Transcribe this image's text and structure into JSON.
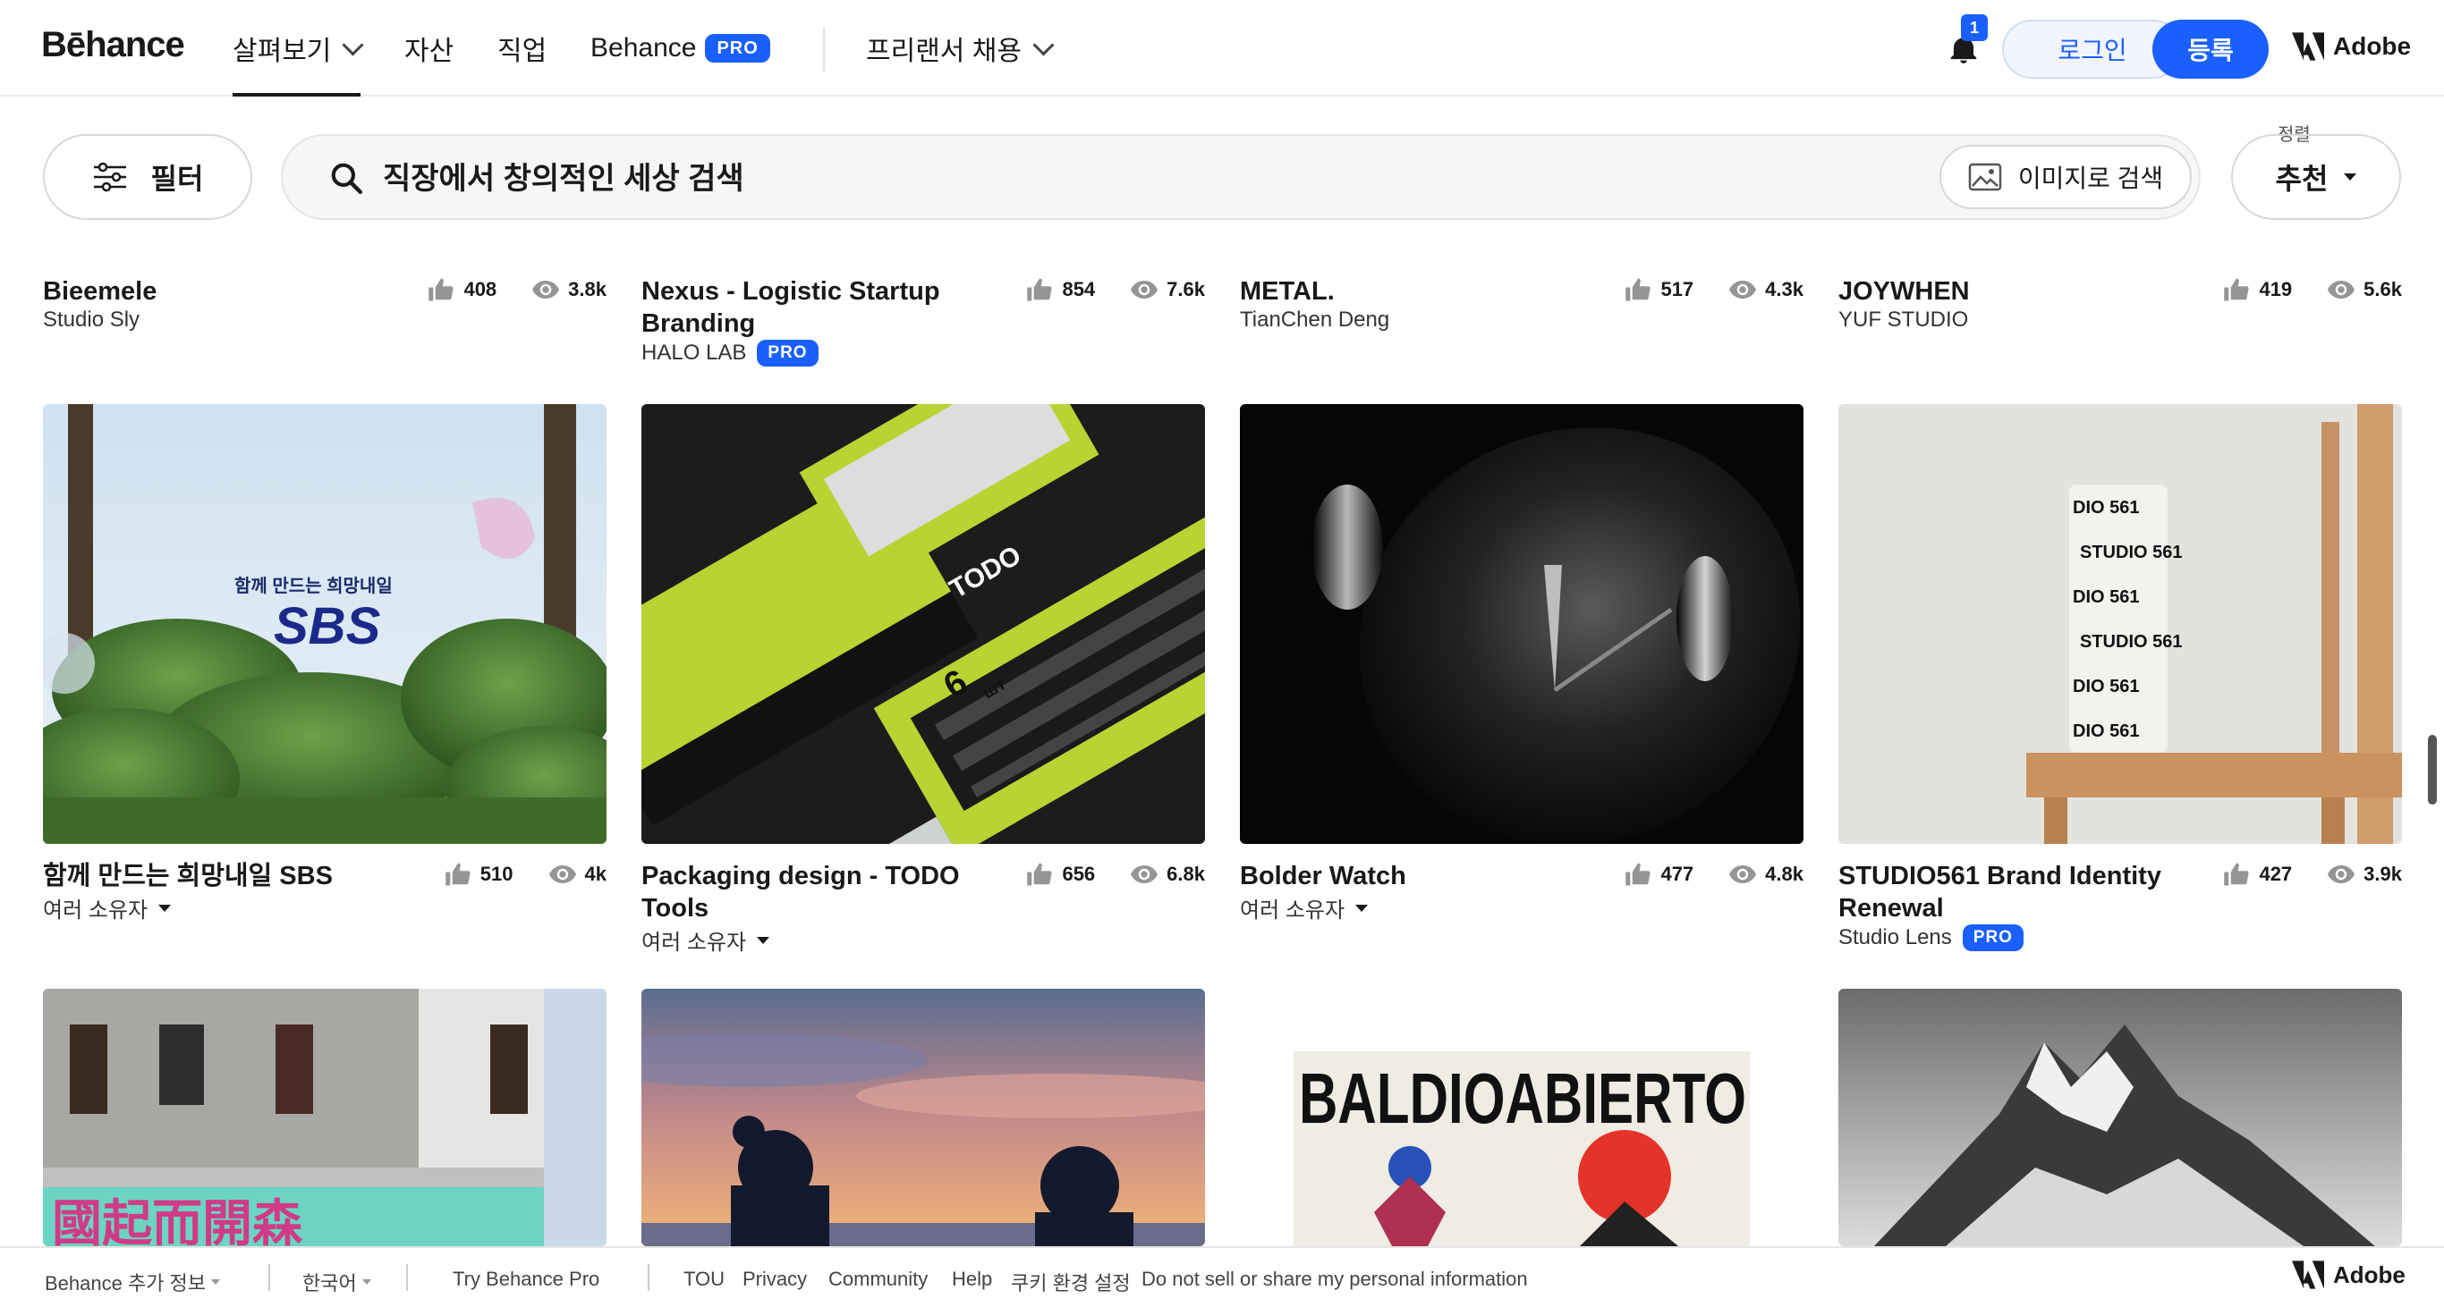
{
  "header": {
    "logo": "Bēhance",
    "nav": {
      "explore": "살펴보기",
      "assets": "자산",
      "jobs": "직업",
      "behance": "Behance",
      "pro_badge": "PRO",
      "hire": "프리랜서 채용"
    },
    "notification_count": "1",
    "login": "로그인",
    "signup": "등록",
    "adobe": "Adobe"
  },
  "filterbar": {
    "filter_label": "필터",
    "search_placeholder": "직장에서 창의적인 세상 검색",
    "image_search": "이미지로 검색",
    "sort_label": "정렬",
    "sort_value": "추천"
  },
  "projects": [
    {
      "title": "Bieemele",
      "owner": "Studio Sly",
      "likes": "408",
      "views": "3.8k",
      "pro": false
    },
    {
      "title": "Nexus - Logistic Startup Branding",
      "owner": "HALO LAB",
      "likes": "854",
      "views": "7.6k",
      "pro": true
    },
    {
      "title": "METAL.",
      "owner": "TianChen Deng",
      "likes": "517",
      "views": "4.3k",
      "pro": false
    },
    {
      "title": "JOYWHEN",
      "owner": "YUF STUDIO",
      "likes": "419",
      "views": "5.6k",
      "pro": false
    },
    {
      "title": "함께 만드는 희망내일 SBS",
      "owner": "여러 소유자",
      "likes": "510",
      "views": "4k",
      "pro": false,
      "multi": true
    },
    {
      "title": "Packaging design - TODO Tools",
      "owner": "여러 소유자",
      "likes": "656",
      "views": "6.8k",
      "pro": false,
      "multi": true
    },
    {
      "title": "Bolder Watch",
      "owner": "여러 소유자",
      "likes": "477",
      "views": "4.8k",
      "pro": false,
      "multi": true
    },
    {
      "title": "STUDIO561 Brand Identity Renewal",
      "owner": "Studio Lens",
      "likes": "427",
      "views": "3.9k",
      "pro": true
    }
  ],
  "thumb_text": {
    "sbs_tagline": "함께 만드는 희망내일",
    "sbs_logo": "SBS",
    "studio561_a": "STUDIO 561",
    "studio561_b": "DIO 561",
    "todo_brand": "TODO",
    "todo_count": "6",
    "todo_unit": "шт",
    "baldio": "BALDIOABIERTO",
    "chinese_sign": "國起而開森"
  },
  "footer": {
    "more_info": "Behance 추가 정보",
    "language": "한국어",
    "try_pro": "Try Behance Pro",
    "tou": "TOU",
    "privacy": "Privacy",
    "community": "Community",
    "help": "Help",
    "cookies": "쿠키 환경 설정",
    "do_not_sell": "Do not sell or share my personal information",
    "adobe": "Adobe"
  },
  "colors": {
    "accent_blue": "#1a5fff",
    "text_dark": "#191919"
  }
}
